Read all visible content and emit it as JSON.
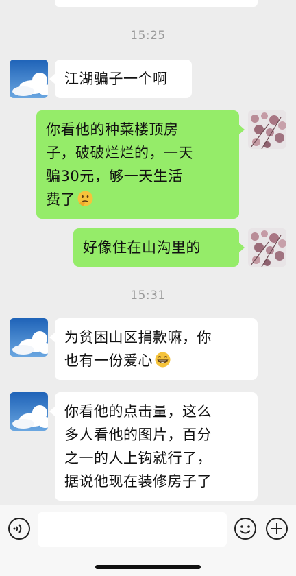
{
  "timestamps": [
    "15:25",
    "15:31"
  ],
  "messages": [
    {
      "side": "left",
      "lines": [
        "江湖骗子一个啊"
      ]
    },
    {
      "side": "right",
      "lines": [
        "你看他的种菜楼顶房",
        "子，破破烂烂的，一天",
        "骗30元，够一天生活",
        "费了"
      ],
      "emoji": "thinking-emoji"
    },
    {
      "side": "right",
      "lines": [
        "好像住在山沟里的"
      ]
    },
    {
      "side": "left",
      "lines": [
        "为贫困山区捐款嘛，你",
        "也有一份爱心"
      ],
      "emoji": "grinning-emoji"
    },
    {
      "side": "left",
      "lines": [
        "你看他的点击量，这么",
        "多人看他的图片，百分",
        "之一的人上钩就行了，",
        "据说他现在装修房子了"
      ]
    }
  ],
  "input": {
    "value": ""
  },
  "icons": {
    "voice": "voice-icon",
    "emoji": "emoji-icon",
    "plus": "plus-icon"
  },
  "colors": {
    "background": "#ededed",
    "bubble_self": "#95ec69",
    "bubble_other": "#ffffff"
  }
}
